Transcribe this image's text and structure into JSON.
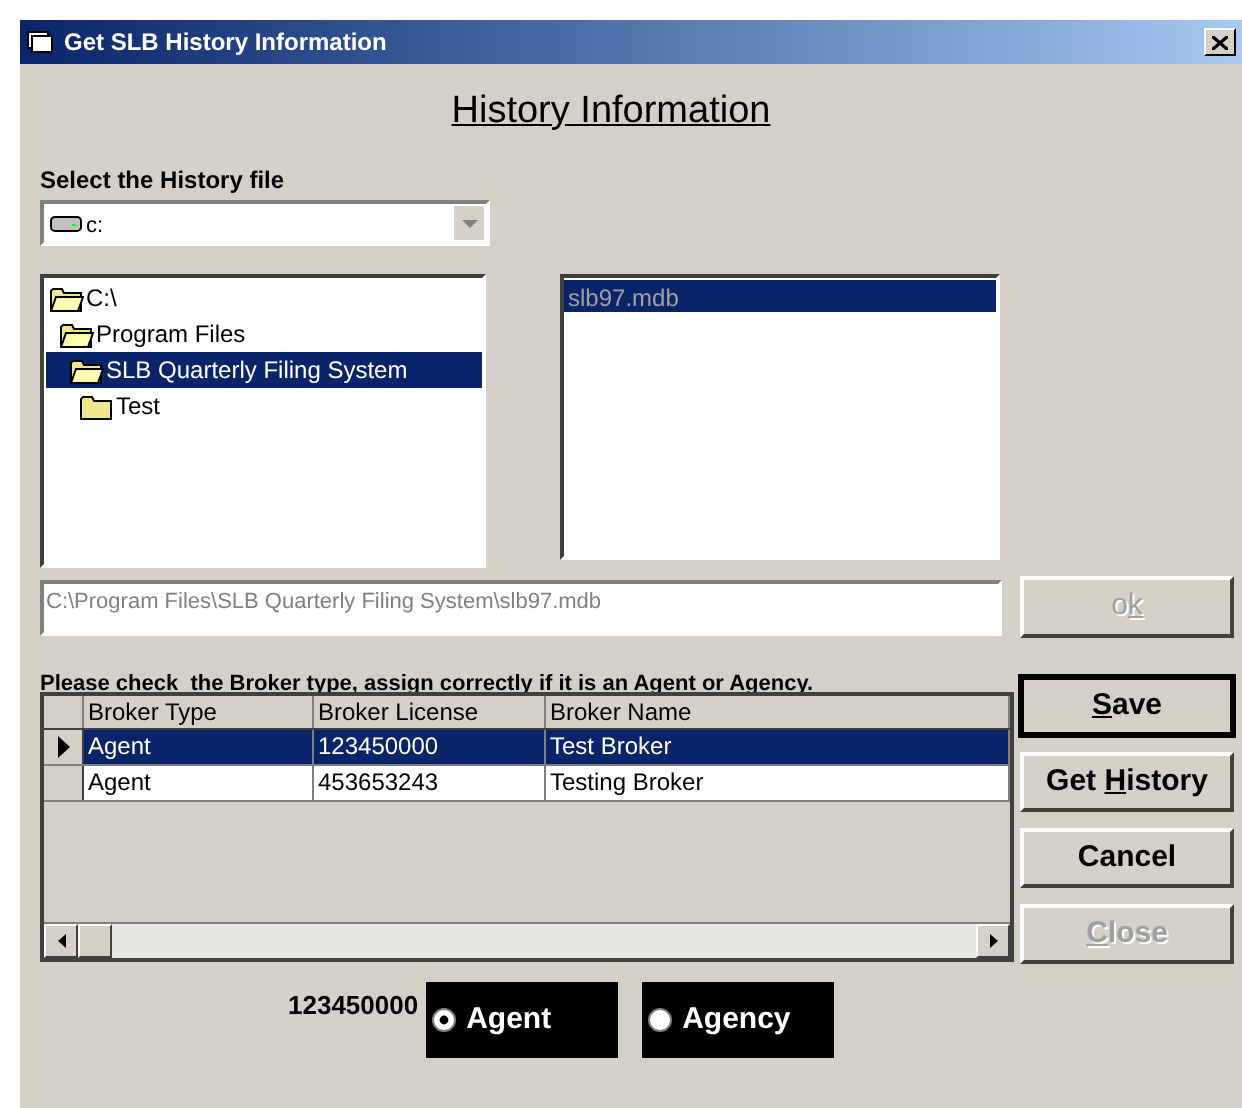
{
  "window": {
    "title": "Get SLB History Information"
  },
  "heading": "History Information",
  "select_label": "Select the History file",
  "drive": {
    "value": "c:"
  },
  "folders": [
    {
      "label": "C:\\",
      "open": true,
      "selected": false,
      "children": [
        {
          "label": "Program Files",
          "open": true,
          "selected": false,
          "children": [
            {
              "label": "SLB Quarterly Filing System",
              "open": true,
              "selected": true,
              "children": [
                {
                  "label": "Test",
                  "open": false,
                  "selected": false
                }
              ]
            }
          ]
        }
      ]
    }
  ],
  "files": [
    {
      "label": "slb97.mdb",
      "selected": true
    }
  ],
  "path": {
    "value": "C:\\Program Files\\SLB Quarterly Filing System\\slb97.mdb",
    "disabled": true
  },
  "ok_button": {
    "label_parts": [
      {
        "text": "o",
        "underline": false
      },
      {
        "text": "k",
        "underline": true
      }
    ],
    "disabled": true
  },
  "instruction": "Please check  the Broker type, assign correctly if it is an Agent or Agency.",
  "table": {
    "columns": [
      "Broker Type",
      "Broker License",
      "Broker Name"
    ],
    "rows": [
      {
        "cells": [
          "Agent",
          "123450000",
          "Test Broker"
        ],
        "selected": true
      },
      {
        "cells": [
          "Agent",
          "453653243",
          "Testing Broker"
        ],
        "selected": false
      }
    ]
  },
  "buttons": [
    {
      "label_parts": [
        {
          "text": "S",
          "underline": true
        },
        {
          "text": "ave",
          "underline": false
        }
      ],
      "disabled": false,
      "default": true
    },
    {
      "label_parts": [
        {
          "text": "Get ",
          "underline": false
        },
        {
          "text": "H",
          "underline": true
        },
        {
          "text": "istory",
          "underline": false
        }
      ],
      "disabled": false,
      "default": false
    },
    {
      "label_parts": [
        {
          "text": "Cancel",
          "underline": false
        }
      ],
      "disabled": false,
      "default": false
    },
    {
      "label_parts": [
        {
          "text": "C",
          "underline": true
        },
        {
          "text": "lose",
          "underline": false
        }
      ],
      "disabled": true,
      "default": false
    }
  ],
  "license": "123450000",
  "broker_type": [
    {
      "label": "Agent",
      "selected": true
    },
    {
      "label": "Agency",
      "selected": false
    }
  ]
}
